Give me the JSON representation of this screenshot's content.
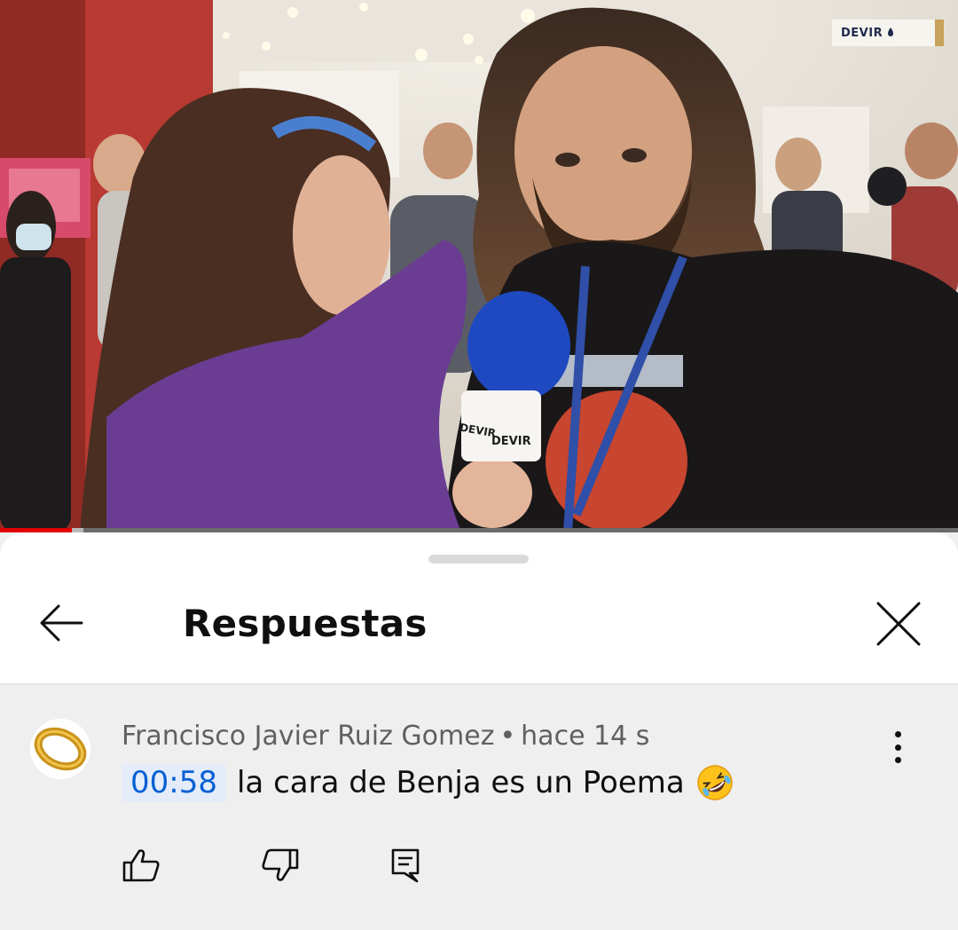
{
  "video": {
    "watermark_brand": "DEVIR",
    "mic_brand_left": "DEVIR",
    "mic_brand_right": "DEVIR",
    "progress_played_fraction": 0.075,
    "progress_buffered_fraction": 0.087,
    "colors": {
      "progress_played": "#e00000"
    }
  },
  "sheet": {
    "title": "Respuestas",
    "back_icon": "arrow-left-icon",
    "close_icon": "close-icon"
  },
  "comment": {
    "author": "Francisco Javier Ruiz Gomez",
    "separator": "•",
    "time_ago": "hace 14 s",
    "timestamp": "00:58",
    "text": "la cara de Benja es un Poema",
    "emoji": "rolling-on-floor-laughing-emoji",
    "avatar": "gold-ring-avatar",
    "actions": {
      "like_icon": "thumbs-up-icon",
      "dislike_icon": "thumbs-down-icon",
      "reply_icon": "reply-comment-icon",
      "more_icon": "more-vertical-icon"
    },
    "colors": {
      "timestamp_text": "#065fd4",
      "timestamp_bg": "#e3ecf8"
    }
  }
}
